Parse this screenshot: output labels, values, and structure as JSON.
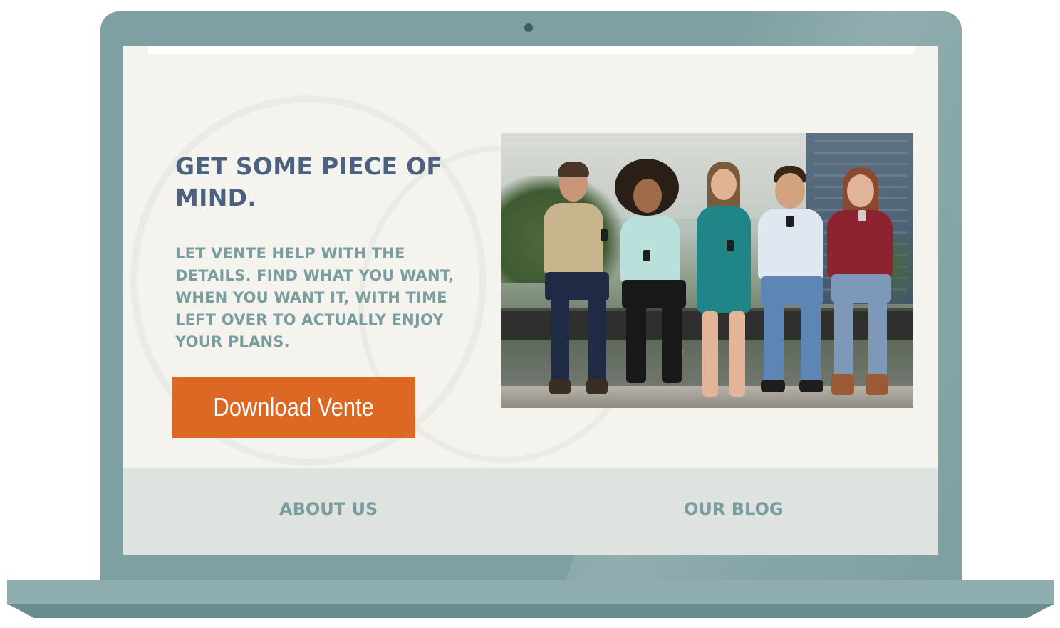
{
  "hero": {
    "headline": "GET SOME PIECE OF MIND.",
    "subcopy": "LET VENTE HELP WITH THE DETAILS. FIND WHAT YOU WANT, WHEN YOU WANT IT, WITH TIME LEFT OVER TO ACTUALLY ENJOY YOUR PLANS.",
    "cta_label": "Download Vente"
  },
  "footer": {
    "about_label": "ABOUT US",
    "blog_label": "OUR BLOG"
  },
  "colors": {
    "laptop_body": "#7fa0a2",
    "screen_bg": "#f5f3ee",
    "headline": "#4c6180",
    "subcopy": "#7a9da0",
    "cta": "#dd6824",
    "footer_bg": "#dfe3df",
    "footer_link": "#7a9da0"
  },
  "image": {
    "subject": "five young friends sitting on a railing looking at their phones"
  }
}
